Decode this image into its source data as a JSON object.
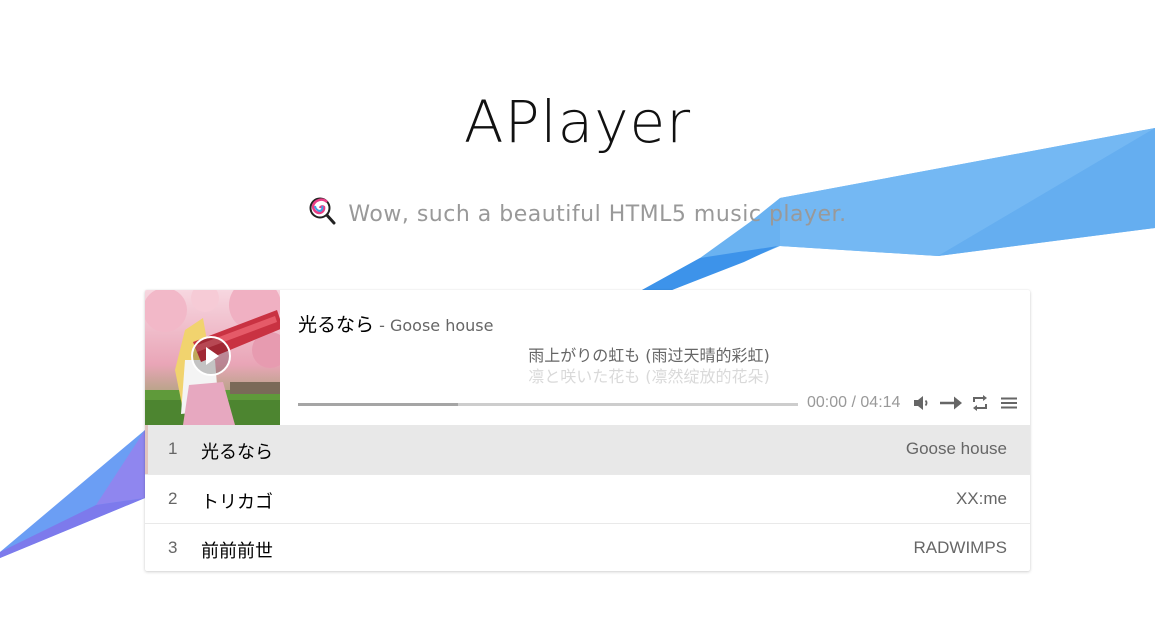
{
  "header": {
    "title": "APlayer",
    "subtitle": "Wow, such a beautiful HTML5 music player.",
    "subtitle_icon": "lollipop-icon"
  },
  "player": {
    "now_playing": {
      "title": "光るなら",
      "author_separator": " - ",
      "author": "Goose house"
    },
    "lyrics": {
      "current": "雨上がりの虹も (雨过天晴的彩虹)",
      "next": "凛と咲いた花も (凛然绽放的花朵)"
    },
    "progress": {
      "played_fraction": 0.32
    },
    "time": {
      "current": "00:00",
      "separator": " / ",
      "total": "04:14"
    },
    "controls": [
      "volume-icon",
      "order-icon",
      "loop-icon",
      "menu-icon"
    ],
    "playlist": [
      {
        "index": "1",
        "title": "光るなら",
        "author": "Goose house",
        "active": true
      },
      {
        "index": "2",
        "title": "トリカゴ",
        "author": "XX:me",
        "active": false
      },
      {
        "index": "3",
        "title": "前前前世",
        "author": "RADWIMPS",
        "active": false
      }
    ]
  },
  "colors": {
    "accent_shape": "#6ab2f1",
    "accent_shape_dark": "#3b8fe6",
    "accent_shape_purple": "#7b7fea",
    "active_row_bg": "#e8e8e8"
  }
}
